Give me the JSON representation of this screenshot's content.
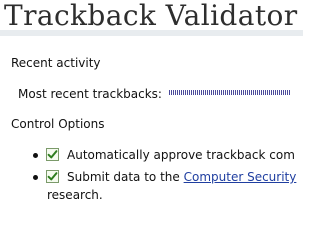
{
  "page": {
    "title": "Trackback Validator"
  },
  "recent_activity": {
    "heading": "Recent activity",
    "most_recent_label": "Most recent trackbacks:",
    "graph_icon": "trackback-activity-sparkline"
  },
  "control_options": {
    "heading": "Control Options",
    "options": [
      {
        "checked": true,
        "text": "Automatically approve trackback com"
      },
      {
        "checked": true,
        "text_before": "Submit data to the ",
        "link_text": "Computer Security",
        "text_after": "research."
      }
    ]
  },
  "colors": {
    "link": "#1f3ea0",
    "checkbox_border": "#7b9a6a",
    "checkmark": "#2e7d1e",
    "title": "#2e2e2e",
    "sparkline": "#4a4a9a"
  }
}
